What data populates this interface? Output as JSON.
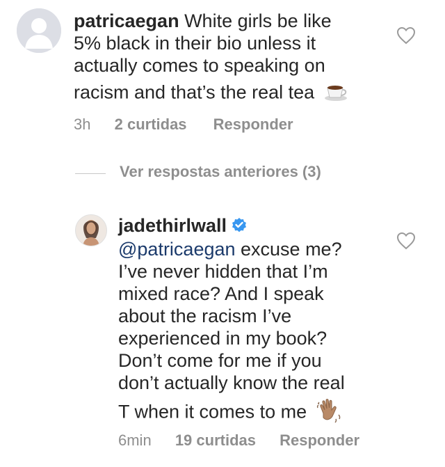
{
  "comment1": {
    "username": "patricaegan",
    "text_lines": [
      "White girls be like",
      "5% black in their bio unless it",
      "actually comes to speaking on",
      "racism and that’s the real tea"
    ],
    "emoji": "coffee-cup-icon",
    "time": "3h",
    "likes": "2 curtidas",
    "reply": "Responder"
  },
  "view_replies": "Ver respostas anteriores (3)",
  "comment2": {
    "username": "jadethirlwall",
    "verified": true,
    "mention": "@patricaegan",
    "text_lines": [
      " excuse me?",
      "I’ve never hidden that I’m",
      "mixed race? And I speak",
      "about the racism I’ve",
      "experienced in my book?",
      "Don’t come for me if you",
      "don’t actually know the real",
      "T when it comes to me"
    ],
    "emoji": "waving-hand-icon",
    "time": "6min",
    "likes": "19 curtidas",
    "reply": "Responder"
  },
  "colors": {
    "text": "#262626",
    "meta": "#8e8e8e",
    "mention": "#1b3a6b",
    "verified": "#3897f0"
  }
}
